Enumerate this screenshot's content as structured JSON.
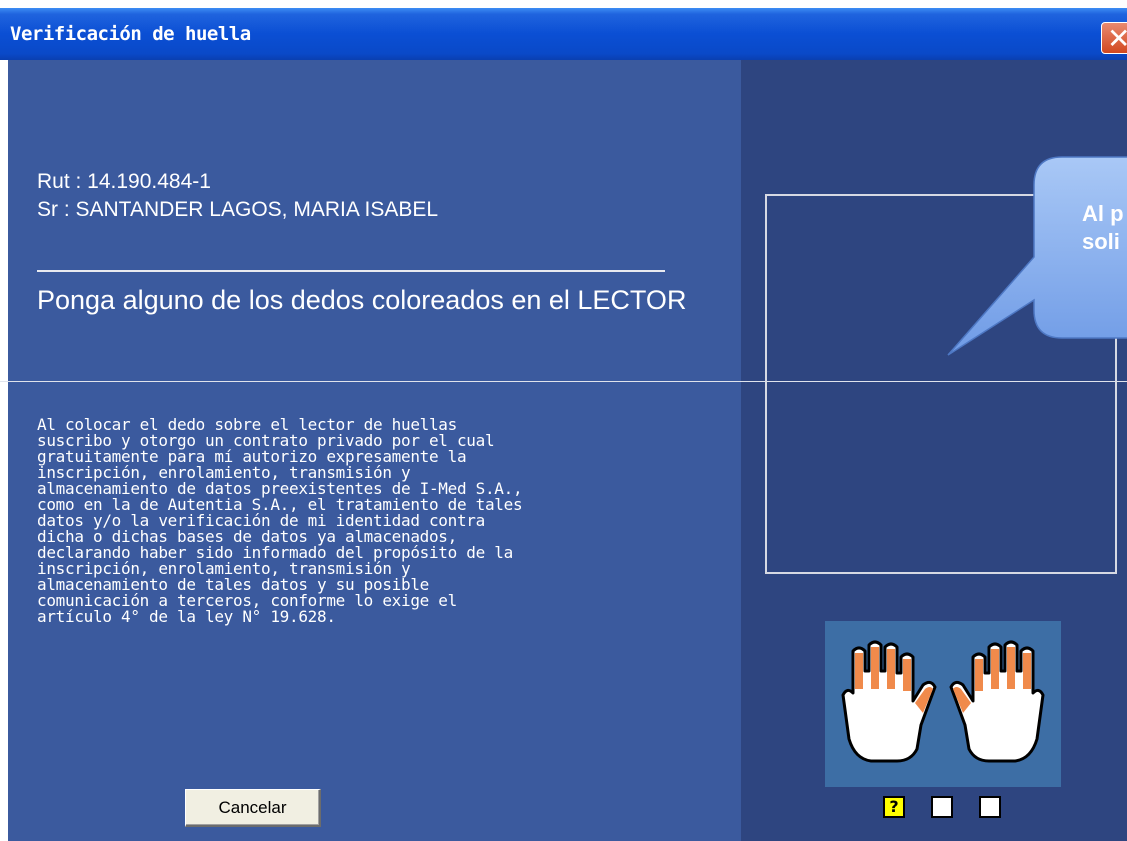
{
  "window": {
    "title": "Verificación de huella",
    "close_glyph": "✕"
  },
  "patient": {
    "rut": "Rut : 14.190.484-1",
    "name": "Sr : SANTANDER LAGOS, MARIA ISABEL"
  },
  "instruction": "Ponga alguno de los dedos coloreados en el LECTOR",
  "legal_text": "Al colocar el dedo sobre el lector de huellas\nsuscribo y otorgo un contrato privado por el cual\ngratuitamente para mí autorizo expresamente la\ninscripción, enrolamiento, transmisión y\nalmacenamiento de datos preexistentes de I-Med S.A.,\ncomo en la de Autentia S.A., el tratamiento de tales\ndatos y/o la verificación de mi identidad contra\ndicha o dichas bases de datos ya almacenados,\ndeclarando haber sido informado del propósito de la\ninscripción, enrolamiento, transmisión y\nalmacenamiento de tales datos y su posible\ncomunicación a terceros, conforme lo exige el\nartículo 4° de la ley N° 19.628.",
  "buttons": {
    "cancel": "Cancelar"
  },
  "callout": {
    "line1": "Al p",
    "line2": "soli"
  },
  "attempt_slots": {
    "active_symbol": "?"
  },
  "colors": {
    "panel_left": "#3b5a9e",
    "panel_right": "#2e4580",
    "finger_highlight": "#f08a4b",
    "slot_active": "#ffff00"
  },
  "icons": [
    "close-icon",
    "left-hand-icon",
    "right-hand-icon"
  ]
}
